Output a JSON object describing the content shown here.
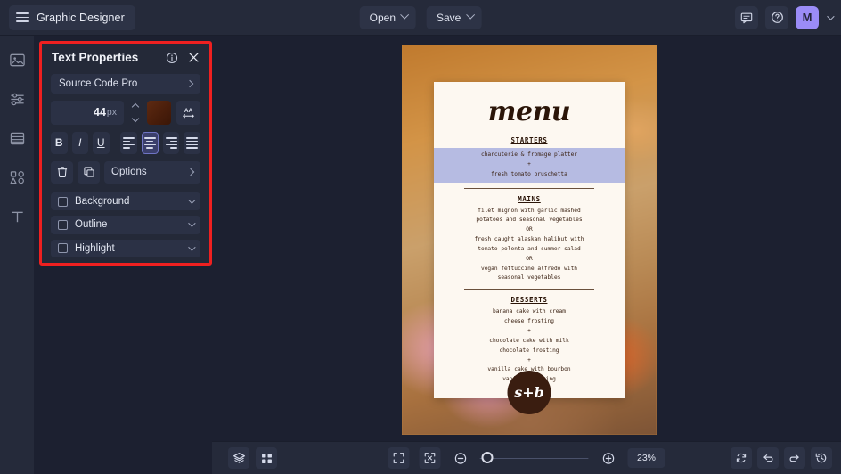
{
  "app": {
    "name": "Graphic Designer",
    "menu_icon": "hamburger-icon"
  },
  "topbar": {
    "open_label": "Open",
    "save_label": "Save",
    "comment_icon": "comment-icon",
    "help_icon": "help-icon",
    "avatar_initial": "M",
    "accent_avatar": "#9b8cf7"
  },
  "left_rail": {
    "items": [
      {
        "name": "image-icon",
        "label": "Image"
      },
      {
        "name": "adjustments-icon",
        "label": "Adjust"
      },
      {
        "name": "layout-icon",
        "label": "Layout"
      },
      {
        "name": "shapes-icon",
        "label": "Elements"
      },
      {
        "name": "text-icon",
        "label": "Text"
      }
    ]
  },
  "panel": {
    "title": "Text Properties",
    "info_icon": "info-icon",
    "close_icon": "close-icon",
    "highlight_border_color": "#ef2020",
    "font": {
      "label": "Source Code Pro"
    },
    "size": {
      "value": "44",
      "unit": "px"
    },
    "color": {
      "swatch_hex": "#4a1e0b"
    },
    "letter_spacing_icon": "letter-spacing-icon",
    "format": {
      "bold": "B",
      "italic": "I",
      "underline": "U",
      "align_left": "align-left-icon",
      "align_center": "align-center-icon",
      "align_right": "align-right-icon",
      "align_justify": "align-justify-icon",
      "selected_align": "center"
    },
    "actions": {
      "delete_icon": "trash-icon",
      "duplicate_icon": "duplicate-icon",
      "options_label": "Options"
    },
    "sections": [
      {
        "label": "Background",
        "checked": false
      },
      {
        "label": "Outline",
        "checked": false
      },
      {
        "label": "Highlight",
        "checked": false
      }
    ]
  },
  "canvas": {
    "design": {
      "title": "menu",
      "logo_text": "s+b",
      "sections": [
        {
          "heading": "STARTERS",
          "selected": true,
          "lines": [
            "charcuterie & fromage platter",
            "+",
            "fresh tomato bruschetta"
          ]
        },
        {
          "heading": "MAINS",
          "selected": false,
          "lines": [
            "filet mignon with garlic mashed",
            "potatoes and seasonal vegetables",
            "OR",
            "fresh caught alaskan halibut with",
            "tomato polenta and summer salad",
            "OR",
            "vegan fettuccine alfredo with",
            "seasonal vegetables"
          ]
        },
        {
          "heading": "DESSERTS",
          "selected": false,
          "lines": [
            "banana cake with cream",
            "cheese frosting",
            "+",
            "chocolate cake with milk",
            "chocolate frosting",
            "+",
            "vanilla cake with bourbon",
            "vanilla frosting"
          ]
        }
      ]
    },
    "selection_highlight_hex": "#b6bbe2"
  },
  "bottombar": {
    "layers_icon": "layers-icon",
    "grid_icon": "grid-icon",
    "fit_icon": "fit-screen-icon",
    "shrink_icon": "shrink-icon",
    "zoom_out_icon": "zoom-out-icon",
    "zoom_in_icon": "zoom-in-icon",
    "zoom_level": "23%",
    "refresh_icon": "refresh-icon",
    "undo_icon": "undo-icon",
    "redo_icon": "redo-icon",
    "history_icon": "history-icon"
  }
}
